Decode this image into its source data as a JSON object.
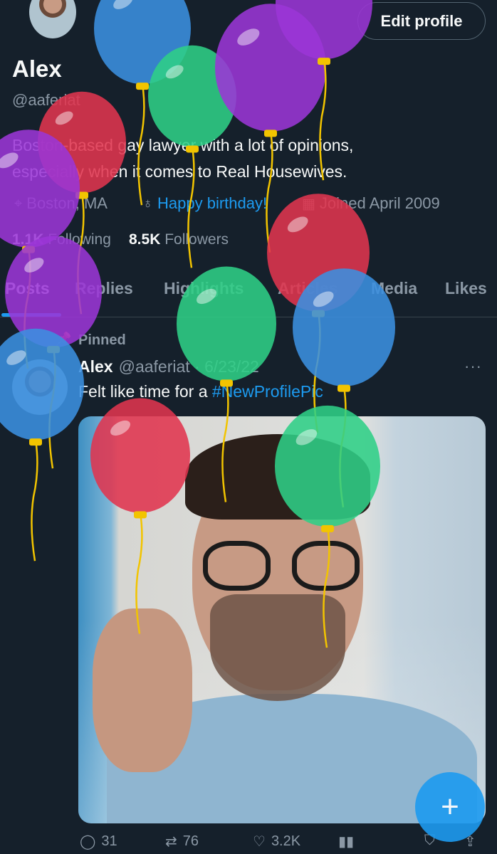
{
  "profile": {
    "name": "Alex",
    "handle": "@aaferiat",
    "edit_label": "Edit profile",
    "bio_line1": "Boston-based gay lawyer with a lot of opinions,",
    "bio_line2": "especially when it comes to Real Housewives.",
    "location": "Boston, MA",
    "birthday_link": "Happy birthday!",
    "joined": "Joined April 2009",
    "following_count": "1.1K",
    "following_label": "Following",
    "followers_count": "8.5K",
    "followers_label": "Followers"
  },
  "tabs": [
    "Posts",
    "Replies",
    "Highlights",
    "Articles",
    "Media",
    "Likes"
  ],
  "pinned_post": {
    "pinned_label": "Pinned",
    "author": "Alex",
    "handle_date": "@aaferiat · 6/23/22",
    "text_prefix": "Felt like time for a ",
    "hashtag": "#NewProfilePic",
    "replies": "31",
    "reposts": "76",
    "likes": "3.2K",
    "more_label": "···"
  },
  "fab_label": "+",
  "colors": {
    "background": "#15202b",
    "accent": "#1d9bf0",
    "muted": "#8b98a5",
    "balloon_red": "#e0344f",
    "balloon_blue": "#3b8fe0",
    "balloon_green": "#2fcf86",
    "balloon_purple": "#9b35d6",
    "balloon_yellow": "#f2c400"
  },
  "icons": {
    "location": "location-pin-icon",
    "link": "link-icon",
    "calendar": "calendar-icon",
    "pin": "pin-icon",
    "reply": "reply-icon",
    "repost": "repost-icon",
    "like": "heart-icon",
    "views": "views-icon",
    "bookmark": "bookmark-icon",
    "share": "share-icon"
  }
}
